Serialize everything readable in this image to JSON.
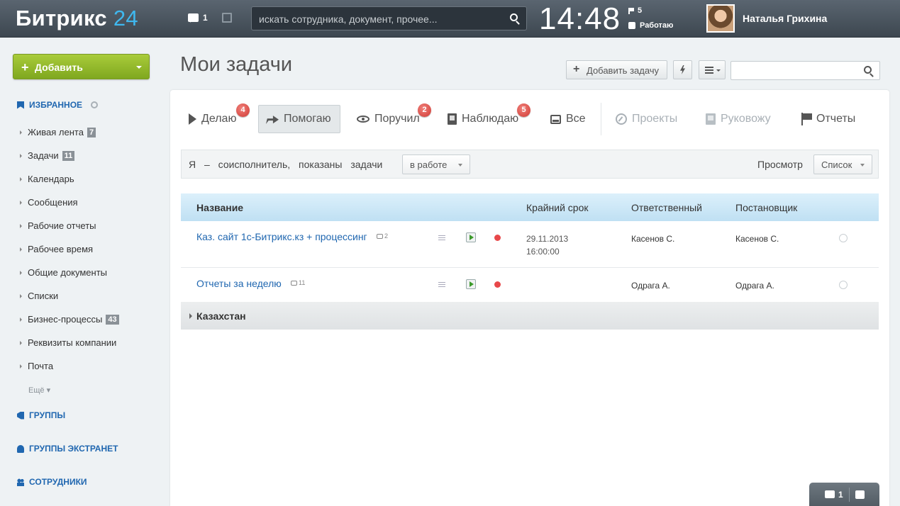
{
  "header": {
    "logo_text": "Битрикс",
    "logo_num": "24",
    "messages_count": "1",
    "search_placeholder": "искать сотрудника, документ, прочее...",
    "clock": "14:48",
    "flags_count": "5",
    "status": "Работаю",
    "user_name": "Наталья Грихина"
  },
  "sidebar": {
    "add_label": "Добавить",
    "favorites_label": "ИЗБРАННОЕ",
    "items": [
      {
        "label": "Живая лента",
        "count": "7"
      },
      {
        "label": "Задачи",
        "count": "11"
      },
      {
        "label": "Календарь",
        "count": ""
      },
      {
        "label": "Сообщения",
        "count": ""
      },
      {
        "label": "Рабочие отчеты",
        "count": ""
      },
      {
        "label": "Рабочее время",
        "count": ""
      },
      {
        "label": "Общие документы",
        "count": ""
      },
      {
        "label": "Списки",
        "count": ""
      },
      {
        "label": "Бизнес-процессы",
        "count": "43"
      },
      {
        "label": "Реквизиты компании",
        "count": ""
      },
      {
        "label": "Почта",
        "count": ""
      }
    ],
    "more_label": "Ещё",
    "groups_label": "ГРУППЫ",
    "extranet_label": "ГРУППЫ ЭКСТРАНЕТ",
    "employees_label": "СОТРУДНИКИ"
  },
  "main": {
    "title": "Мои задачи",
    "add_task_label": "Добавить задачу",
    "tabs": [
      {
        "label": "Делаю",
        "badge": "4"
      },
      {
        "label": "Помогаю",
        "badge": ""
      },
      {
        "label": "Поручил",
        "badge": "2"
      },
      {
        "label": "Наблюдаю",
        "badge": "5"
      },
      {
        "label": "Все",
        "badge": ""
      },
      {
        "label": "Проекты",
        "badge": ""
      },
      {
        "label": "Руковожу",
        "badge": ""
      },
      {
        "label": "Отчеты",
        "badge": ""
      }
    ],
    "filter": {
      "text": "Я – соисполнитель, показаны задачи",
      "status_value": "в работе",
      "view_label": "Просмотр",
      "view_value": "Список"
    },
    "table": {
      "columns": [
        "Название",
        "Крайний срок",
        "Ответственный",
        "Постановщик"
      ],
      "rows": [
        {
          "title": "Каз. сайт 1с-Битрикс.кз + процессинг",
          "comments": "2",
          "deadline_date": "29.11.2013",
          "deadline_time": "16:00:00",
          "responsible": "Касенов С.",
          "creator": "Касенов С."
        },
        {
          "title": "Отчеты за неделю",
          "comments": "11",
          "deadline_date": "",
          "deadline_time": "",
          "responsible": "Одрага А.",
          "creator": "Одрага А."
        }
      ],
      "group_label": "Казахстан"
    }
  },
  "chat": {
    "messages_count": "1"
  },
  "colors": {
    "brand_blue": "#2067b0",
    "add_green": "#8db52b",
    "badge_red": "#d03a34"
  }
}
